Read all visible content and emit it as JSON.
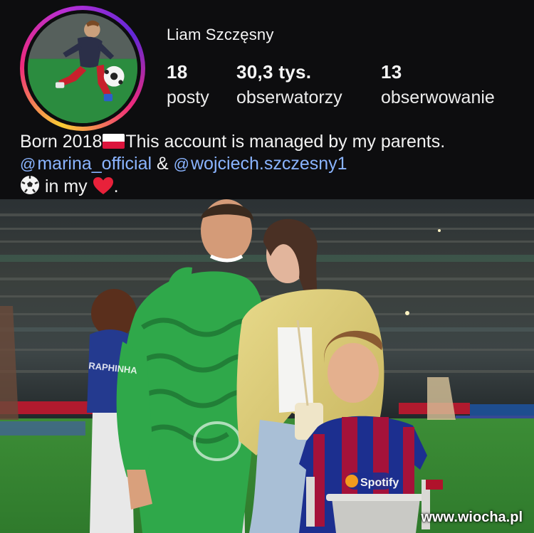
{
  "profile": {
    "username": "Liam Szczęsny",
    "stats": {
      "posts": {
        "value": "18",
        "label": "posty"
      },
      "followers": {
        "value": "30,3 tys.",
        "label": "obserwatorzy"
      },
      "following": {
        "value": "13",
        "label": "obserwowanie"
      }
    },
    "bio": {
      "born": "Born 2018",
      "managed": "This account is managed by my parents.",
      "mention1": "marina_official",
      "amp": " & ",
      "mention2": "wojciech.szczesny1",
      "in_my": " in my ",
      "period": "."
    },
    "icons": {
      "flag": "poland-flag-icon",
      "threads": "threads-icon",
      "ball": "soccer-ball-icon",
      "heart": "red-heart-icon"
    }
  },
  "photo": {
    "jersey_sponsor": "Spotify",
    "shirt_name": "RAPHINHA"
  },
  "watermark": "www.wiocha.pl",
  "colors": {
    "mention": "#8ab4ff",
    "keeper_green": "#2fa84a",
    "barca_blue": "#1c2f8f",
    "barca_red": "#a5123a"
  }
}
